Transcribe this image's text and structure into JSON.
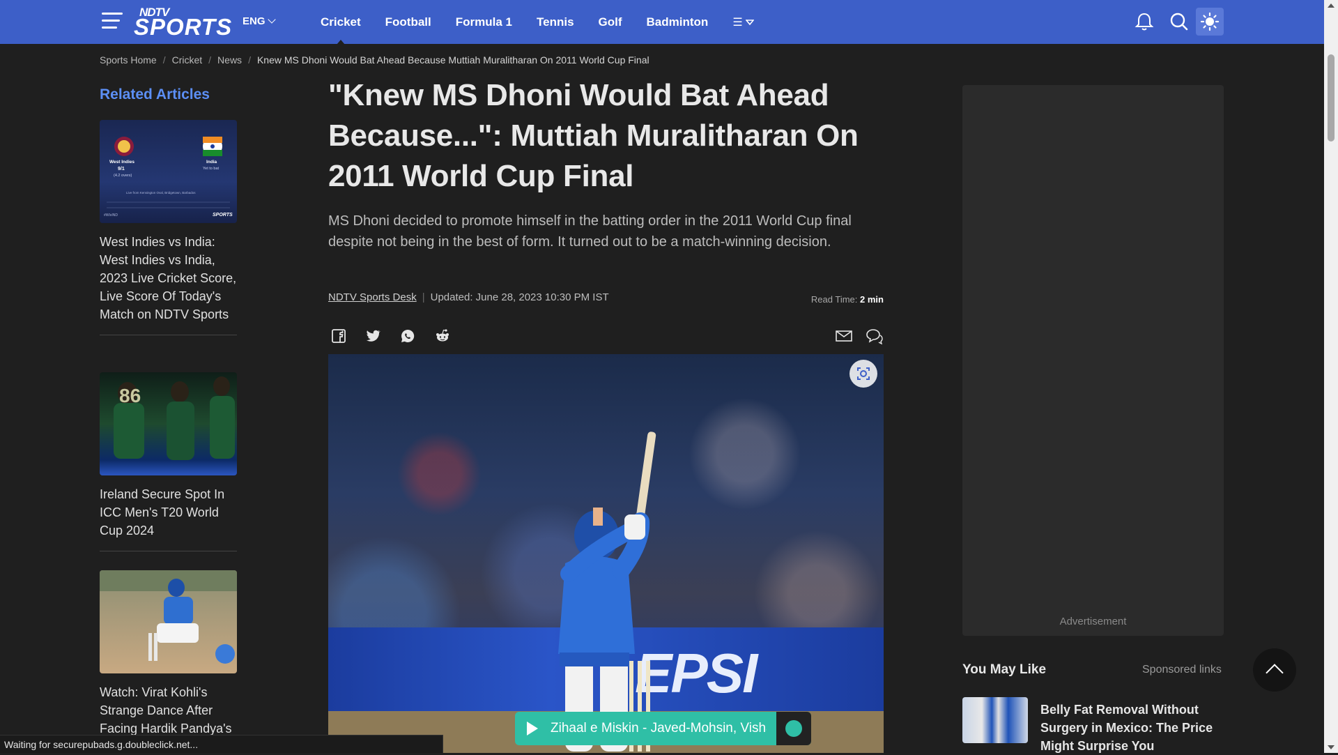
{
  "header": {
    "logo_top": "NDTV",
    "logo_main": "SPORTS",
    "language": "ENG",
    "nav": [
      "Cricket",
      "Football",
      "Formula 1",
      "Tennis",
      "Golf",
      "Badminton"
    ],
    "more_label": "☰"
  },
  "breadcrumb": {
    "items": [
      "Sports Home",
      "Cricket",
      "News"
    ],
    "current": "Knew MS Dhoni Would Bat Ahead Because Muttiah Muralitharan On 2011 World Cup Final"
  },
  "related": {
    "title": "Related Articles",
    "items": [
      {
        "caption": "West Indies vs India: West Indies vs India, 2023 Live Cricket Score, Live Score Of Today's Match on NDTV Sports",
        "thumb": {
          "team1": "West Indies",
          "score1": "9/1",
          "overs1": "(4.2 overs)",
          "team2": "India",
          "status2": "Yet to bat",
          "venue": "Live from Kensington Oval, Bridgetown, Barbados",
          "brand": "SPORTS",
          "tag": "#WIvIND"
        }
      },
      {
        "caption": "Ireland Secure Spot In ICC Men's T20 World Cup 2024",
        "thumb_number": "86"
      },
      {
        "caption": "Watch: Virat Kohli's Strange Dance After Facing Hardik Pandya's"
      }
    ]
  },
  "article": {
    "headline": "\"Knew MS Dhoni Would Bat Ahead Because...\": Muttiah Muralitharan On 2011 World Cup Final",
    "summary": "MS Dhoni decided to promote himself in the batting order in the 2011 World Cup final despite not being in the best of form. It turned out to be a match-winning decision.",
    "author": "NDTV Sports Desk",
    "updated": "Updated: June 28, 2023 10:30 PM IST",
    "read_time_label": "Read Time:",
    "read_time_value": "2 min",
    "share_icons": [
      "facebook-icon",
      "twitter-icon",
      "whatsapp-icon",
      "reddit-icon"
    ],
    "hero_banner_text": "EPSI"
  },
  "music_player": {
    "title": "Zihaal e Miskin - Javed-Mohsin, Vishal"
  },
  "sidebar": {
    "ad_label": "Advertisement",
    "you_may_like": "You May Like",
    "sponsored": "Sponsored links",
    "promo_title": "Belly Fat Removal Without Surgery in Mexico: The Price Might Surprise You"
  },
  "statusbar": {
    "text": "Waiting for securepubads.g.doubleclick.net..."
  },
  "colors": {
    "header_bg": "#3d5fc8",
    "page_bg": "#1f1f1f",
    "accent_link": "#5c8ff5",
    "music_bar": "#2fbfa6"
  }
}
